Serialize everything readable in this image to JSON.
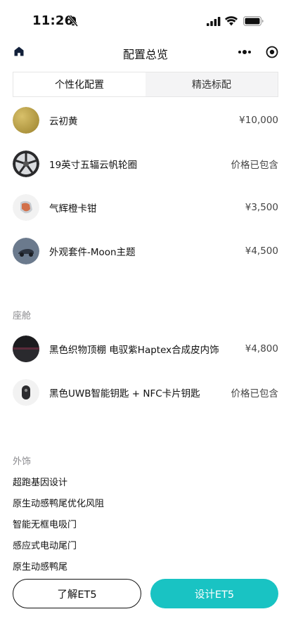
{
  "status_bar": {
    "time": "11:26"
  },
  "nav": {
    "title": "配置总览"
  },
  "tabs": [
    {
      "label": "个性化配置",
      "active": true
    },
    {
      "label": "精选标配",
      "active": false
    }
  ],
  "items": [
    {
      "name": "云初黄",
      "price": "¥10,000",
      "icon": "gold-paint-swatch"
    },
    {
      "name": "19英寸五辐云帆轮圈",
      "price": "价格已包含",
      "icon": "wheel-rim"
    },
    {
      "name": "气辉橙卡钳",
      "price": "¥3,500",
      "icon": "brake-caliper"
    },
    {
      "name": "外观套件-Moon主题",
      "price": "¥4,500",
      "icon": "moon-kit"
    }
  ],
  "cabin": {
    "title": "座舱",
    "items": [
      {
        "name": "黑色织物顶棚 电驭紫Haptex合成皮内饰",
        "price": "¥4,800",
        "icon": "interior-swatch"
      },
      {
        "name": "黑色UWB智能钥匙 + NFC卡片钥匙",
        "price": "价格已包含",
        "icon": "smart-key"
      }
    ]
  },
  "exterior": {
    "title": "外饰",
    "items": [
      "超跑基因设计",
      "原生动感鸭尾优化风阻",
      "智能无框电吸门",
      "感应式电动尾门",
      "原生动感鸭尾"
    ]
  },
  "footer": {
    "learn_label": "了解ET5",
    "design_label": "设计ET5"
  },
  "colors": {
    "accent": "#19c3c3",
    "text": "#111111",
    "muted": "#8a8a8e"
  }
}
